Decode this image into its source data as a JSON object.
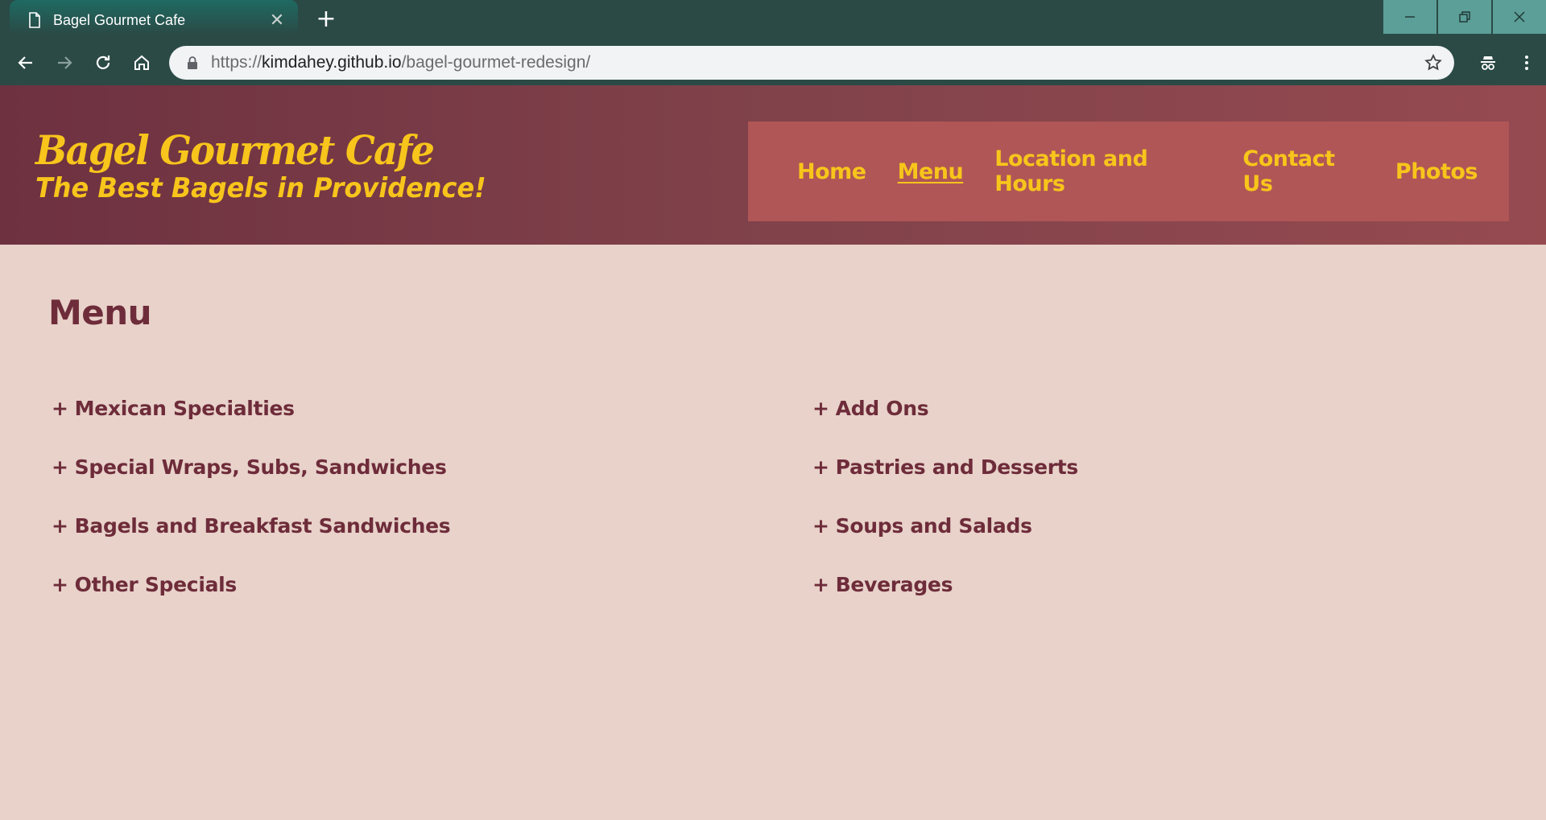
{
  "browser": {
    "tab_title": "Bagel Gourmet Cafe",
    "tab_close": "✕",
    "new_tab": "+",
    "url_scheme": "https://",
    "url_host": "kimdahey.github.io",
    "url_path": "/bagel-gourmet-redesign/"
  },
  "header": {
    "title": "Bagel Gourmet Cafe",
    "tagline": "The Best Bagels in Providence!"
  },
  "nav": {
    "items": [
      {
        "label": "Home",
        "active": false
      },
      {
        "label": "Menu",
        "active": true
      },
      {
        "label": "Location and Hours",
        "active": false
      },
      {
        "label": "Contact Us",
        "active": false
      },
      {
        "label": "Photos",
        "active": false
      }
    ]
  },
  "main": {
    "title": "Menu",
    "expand_symbol": "+",
    "left_items": [
      "Mexican Specialties",
      "Special Wraps, Subs, Sandwiches",
      "Bagels and Breakfast Sandwiches",
      "Other Specials"
    ],
    "right_items": [
      "Add Ons",
      "Pastries and Desserts",
      "Soups and Salads",
      "Beverages"
    ]
  },
  "colors": {
    "accent_yellow": "#f7c51b",
    "nav_bg": "#b05656",
    "text_maroon": "#6e2c3a",
    "page_bg": "#e8d2ca"
  }
}
